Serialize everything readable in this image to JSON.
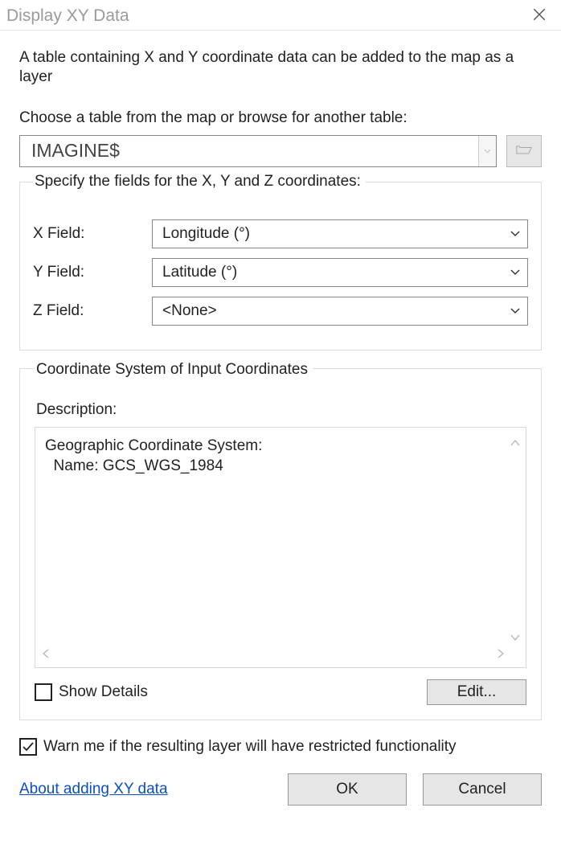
{
  "window": {
    "title": "Display XY Data"
  },
  "intro": "A table containing X and Y coordinate data can be added to the map as a layer",
  "chooseLabel": "Choose a table from the map or browse for another table:",
  "table": {
    "selected": "IMAGINE$"
  },
  "fieldsGroup": {
    "legend": "Specify the fields for the X, Y and Z coordinates:",
    "x": {
      "label": "X Field:",
      "value": "Longitude (°)"
    },
    "y": {
      "label": "Y Field:",
      "value": "Latitude (°)"
    },
    "z": {
      "label": "Z Field:",
      "value": "<None>"
    }
  },
  "csGroup": {
    "legend": "Coordinate System of Input Coordinates",
    "descriptionLabel": "Description:",
    "descriptionText": "Geographic Coordinate System:\n  Name: GCS_WGS_1984",
    "showDetailsLabel": "Show Details",
    "editLabel": "Edit..."
  },
  "warnLabel": "Warn me if the resulting layer will have restricted functionality",
  "link": "About adding XY data",
  "buttons": {
    "ok": "OK",
    "cancel": "Cancel"
  }
}
